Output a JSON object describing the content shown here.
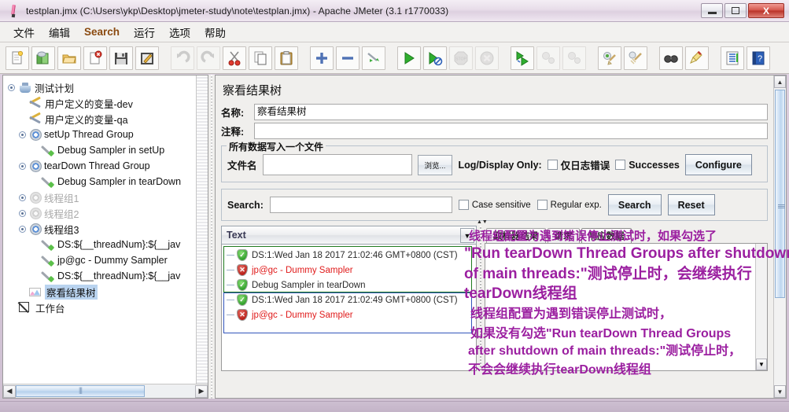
{
  "window": {
    "title": "testplan.jmx (C:\\Users\\ykp\\Desktop\\jmeter-study\\note\\testplan.jmx) - Apache JMeter (3.1 r1770033)",
    "minimize": "–",
    "maximize": "□",
    "close": "X"
  },
  "menubar": {
    "items": [
      {
        "label": "文件"
      },
      {
        "label": "编辑"
      },
      {
        "label": "Search",
        "accent": true
      },
      {
        "label": "运行"
      },
      {
        "label": "选项"
      },
      {
        "label": "帮助"
      }
    ]
  },
  "toolbar": {
    "buttons": [
      {
        "name": "new-icon",
        "enabled": true
      },
      {
        "name": "templates-icon",
        "enabled": true
      },
      {
        "name": "open-icon",
        "enabled": true
      },
      {
        "name": "close-icon",
        "enabled": true
      },
      {
        "name": "save-icon",
        "enabled": true
      },
      {
        "name": "save-as-icon",
        "enabled": true
      },
      {
        "name": "undo-icon",
        "enabled": false
      },
      {
        "name": "redo-icon",
        "enabled": false
      },
      {
        "name": "cut-icon",
        "enabled": true
      },
      {
        "name": "copy-icon",
        "enabled": true
      },
      {
        "name": "paste-icon",
        "enabled": true
      },
      {
        "name": "expand-all-icon",
        "enabled": true
      },
      {
        "name": "collapse-all-icon",
        "enabled": true
      },
      {
        "name": "toggle-icon",
        "enabled": true
      },
      {
        "name": "start-icon",
        "enabled": true
      },
      {
        "name": "start-no-pauses-icon",
        "enabled": true
      },
      {
        "name": "stop-icon",
        "enabled": false
      },
      {
        "name": "shutdown-icon",
        "enabled": false
      },
      {
        "name": "start-remote-all-icon",
        "enabled": true
      },
      {
        "name": "stop-remote-all-icon",
        "enabled": false
      },
      {
        "name": "shutdown-remote-all-icon",
        "enabled": false
      },
      {
        "name": "clear-icon",
        "enabled": true
      },
      {
        "name": "clear-all-icon",
        "enabled": true
      },
      {
        "name": "search-icon",
        "enabled": true
      },
      {
        "name": "reset-search-icon",
        "enabled": true
      },
      {
        "name": "function-helper-icon",
        "enabled": true
      },
      {
        "name": "help-icon",
        "enabled": true
      }
    ]
  },
  "tree": {
    "nodes": [
      {
        "label": "测试计划",
        "icon": "flask-icon",
        "depth": 0,
        "dim": false,
        "selected": false,
        "expander": true
      },
      {
        "label": "用户定义的变量-dev",
        "icon": "tools-icon",
        "depth": 1,
        "dim": false,
        "selected": false,
        "expander": false
      },
      {
        "label": "用户定义的变量-qa",
        "icon": "tools-icon",
        "depth": 1,
        "dim": false,
        "selected": false,
        "expander": false
      },
      {
        "label": "setUp Thread Group",
        "icon": "thread-group-icon",
        "depth": 1,
        "dim": false,
        "selected": false,
        "expander": true
      },
      {
        "label": "Debug Sampler in setUp",
        "icon": "sampler-icon",
        "depth": 2,
        "dim": false,
        "selected": false,
        "expander": false
      },
      {
        "label": "tearDown Thread Group",
        "icon": "thread-group-icon",
        "depth": 1,
        "dim": false,
        "selected": false,
        "expander": true
      },
      {
        "label": "Debug Sampler in tearDown",
        "icon": "sampler-icon",
        "depth": 2,
        "dim": false,
        "selected": false,
        "expander": false
      },
      {
        "label": "线程组1",
        "icon": "thread-group-icon",
        "depth": 1,
        "dim": true,
        "selected": false,
        "expander": true
      },
      {
        "label": "线程组2",
        "icon": "thread-group-icon",
        "depth": 1,
        "dim": true,
        "selected": false,
        "expander": true
      },
      {
        "label": "线程组3",
        "icon": "thread-group-icon",
        "depth": 1,
        "dim": false,
        "selected": false,
        "expander": true
      },
      {
        "label": "DS:${__threadNum}:${__jav",
        "icon": "sampler-icon",
        "depth": 2,
        "dim": false,
        "selected": false,
        "expander": false
      },
      {
        "label": "jp@gc - Dummy Sampler",
        "icon": "sampler-icon",
        "depth": 2,
        "dim": false,
        "selected": false,
        "expander": false
      },
      {
        "label": "DS:${__threadNum}:${__jav",
        "icon": "sampler-icon",
        "depth": 2,
        "dim": false,
        "selected": false,
        "expander": false
      },
      {
        "label": "察看结果树",
        "icon": "view-results-tree-icon",
        "depth": 1,
        "dim": false,
        "selected": true,
        "expander": false
      },
      {
        "label": "工作台",
        "icon": "workbench-icon",
        "depth": 0,
        "dim": false,
        "selected": false,
        "expander": false
      }
    ]
  },
  "panel": {
    "title": "察看结果树",
    "name_label": "名称:",
    "name_value": "察看结果树",
    "comment_label": "注释:",
    "comment_value": "",
    "file_group": {
      "legend": "所有数据写入一个文件",
      "filename_label": "文件名",
      "filename_value": "",
      "browse_button": "浏览...",
      "log_display_only_label": "Log/Display Only:",
      "errors_only_label": "仅日志错误",
      "successes_label": "Successes",
      "configure_button": "Configure"
    },
    "search": {
      "label": "Search:",
      "value": "",
      "case_sensitive_label": "Case sensitive",
      "regular_exp_label": "Regular exp.",
      "search_button": "Search",
      "reset_button": "Reset"
    },
    "renderer": {
      "selected": "Text",
      "dropdown_arrow": "▼"
    },
    "tabs": [
      {
        "label": "取样器结果",
        "active": false
      },
      {
        "label": "请求",
        "active": false
      },
      {
        "label": "响应数据",
        "active": true
      }
    ],
    "results": [
      {
        "text": "DS:1:Wed Jan 18 2017 21:02:46 GMT+0800 (CST)",
        "status": "ok",
        "group": "green"
      },
      {
        "text": "jp@gc - Dummy Sampler",
        "status": "error",
        "group": "green"
      },
      {
        "text": "Debug Sampler in tearDown",
        "status": "ok",
        "group": "green"
      },
      {
        "text": "DS:1:Wed Jan 18 2017 21:02:49 GMT+0800 (CST)",
        "status": "ok",
        "group": "blue"
      },
      {
        "text": "jp@gc - Dummy Sampler",
        "status": "error",
        "group": "blue"
      }
    ]
  },
  "annotations": {
    "line1": "线程组配置为遇到错误停止测试时，如果勾选了",
    "line2": "\"Run tearDown Thread Groups after shutdown",
    "line3": "of main threads:\"测试停止时，会继续执行",
    "line4": "tearDown线程组",
    "line5": "线程组配置为遇到错误停止测试时，",
    "line6": "如果没有勾选\"Run tearDown Thread Groups",
    "line7": "after shutdown of main threads:\"测试停止时，",
    "line8": "不会会继续执行tearDown线程组",
    "color": "#9b1fa0"
  },
  "scrollbars": {
    "up_arrow": "▲",
    "down_arrow": "▼",
    "left_arrow": "◀",
    "right_arrow": "▶"
  }
}
